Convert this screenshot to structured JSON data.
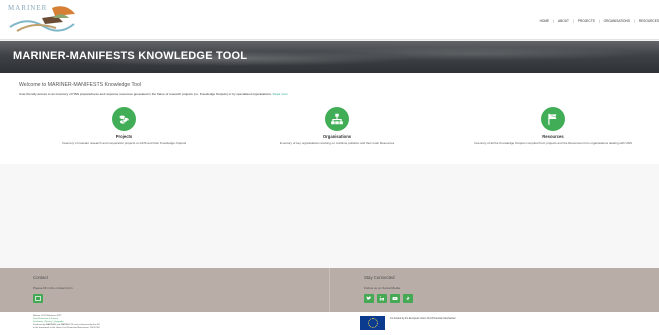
{
  "header": {
    "logo_text": "MARINER",
    "nav": [
      "HOME",
      "ABOUT",
      "PROJECTS",
      "ORGANISATIONS",
      "RESOURCES"
    ]
  },
  "hero": {
    "title": "MARINER-MANIFESTS KNOWLEDGE TOOL"
  },
  "main": {
    "welcome": "Welcome to MARINER-MANIFESTS Knowledge Tool",
    "intro": "User-friendly access to an inventory of HNS preparedness and response resources generated in the frame of research projects (i.e. Knowledge Outputs) or by specialised organisations.",
    "read_more": "Read more",
    "features": [
      {
        "title": "Projects",
        "description": "Inventory of relevant research and cooperation projects on HNS and their Knowledge Outputs",
        "icon": "stack-icon"
      },
      {
        "title": "Organisations",
        "description": "Inventory of key organisations working on maritime pollution and their main Resources",
        "icon": "organisation-icon"
      },
      {
        "title": "Resources",
        "description": "Inventory of all the Knowledge Outputs compiled from projects and the Resources from organisations dealing with HNS",
        "icon": "flag-icon"
      }
    ]
  },
  "footer": {
    "contact": {
      "title": "Contact",
      "text": "Please fill in the contact form"
    },
    "social": {
      "title": "Stay Connected",
      "text": "Follow us on Social Media"
    },
    "legal": {
      "line1": "Mariner 2017 Manifests 2022",
      "line2": "Data Protection & Privacy",
      "line3": "Disclaimer | Privacy | Copyright",
      "line4": "Produced by MARINER and MANIFESTS and co-financed by the EU",
      "line5": "in the framework of the Union Civil Protection Mechanism, DG ECHO"
    },
    "eu_text": "Co-funded by the European Union Civil Protection Mechanism"
  },
  "colors": {
    "accent": "#41ae57",
    "footer_bg": "#b8aea7",
    "hero_bg": "#3e4246"
  }
}
